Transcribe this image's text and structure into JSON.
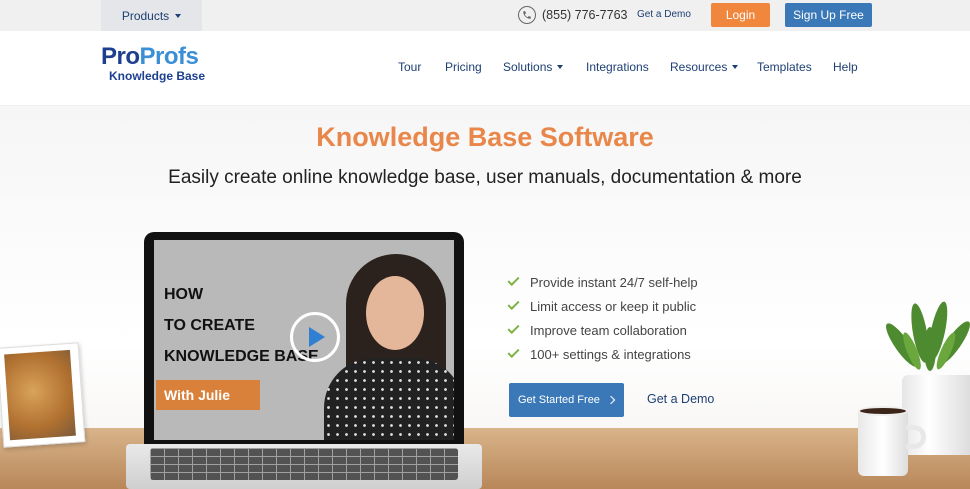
{
  "topbar": {
    "products_label": "Products",
    "phone": "(855) 776-7763",
    "get_demo": "Get a Demo",
    "login": "Login",
    "signup": "Sign Up Free"
  },
  "logo": {
    "pro1": "Pro",
    "pro2": "Profs",
    "subtitle": "Knowledge Base"
  },
  "nav": {
    "items": [
      {
        "label": "Tour",
        "dropdown": false
      },
      {
        "label": "Pricing",
        "dropdown": false
      },
      {
        "label": "Solutions",
        "dropdown": true
      },
      {
        "label": "Integrations",
        "dropdown": false
      },
      {
        "label": "Resources",
        "dropdown": true
      },
      {
        "label": "Templates",
        "dropdown": false
      },
      {
        "label": "Help",
        "dropdown": false
      }
    ]
  },
  "hero": {
    "title": "Knowledge Base Software",
    "subtitle": "Easily create online knowledge base, user manuals, documentation & more"
  },
  "video": {
    "line1": "HOW",
    "line2": "TO CREATE",
    "line3": "KNOWLEDGE BASE",
    "presenter": "With Julie"
  },
  "features": [
    "Provide instant 24/7 self-help",
    "Limit access or keep it public",
    "Improve team collaboration",
    "100+ settings & integrations"
  ],
  "cta": {
    "primary": "Get Started Free",
    "secondary": "Get a Demo"
  },
  "colors": {
    "accent_orange": "#f0873d",
    "title_orange": "#e9874a",
    "brand_blue": "#3a78b8",
    "nav_text": "#1d3f73",
    "check_green": "#7cb342"
  },
  "icons": {
    "phone": "phone-icon",
    "play": "play-icon",
    "check": "check-icon",
    "chevron": "chevron-right-icon"
  }
}
